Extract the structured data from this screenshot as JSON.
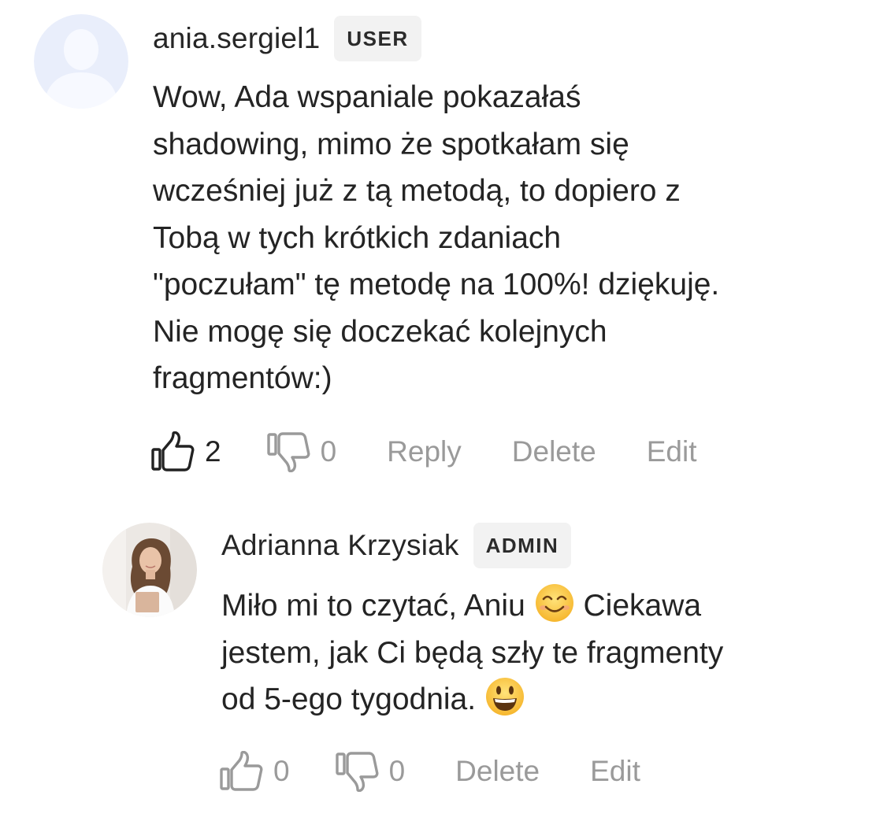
{
  "comments": [
    {
      "author": "ania.sergiel1",
      "badge": "USER",
      "avatar_icon": "default-user-icon",
      "lines": [
        "Wow, Ada wspaniale pokazałaś",
        "shadowing, mimo że spotkałam się",
        "wcześniej już z tą metodą, to dopiero z",
        "Tobą w tych krótkich zdaniach",
        "\"poczułam\" tę metodę na 100%! dziękuję.",
        "Nie mogę się doczekać kolejnych",
        "fragmentów:)"
      ],
      "likes": "2",
      "dislikes": "0",
      "actions": [
        "Reply",
        "Delete",
        "Edit"
      ]
    },
    {
      "author": "Adrianna Krzysiak",
      "badge": "ADMIN",
      "avatar_icon": "profile-photo",
      "line1_a": "Miło mi to czytać, Aniu",
      "line1_b": "Ciekawa",
      "line2": "jestem, jak Ci będą szły te fragmenty",
      "line3": "od 5-ego tygodnia.",
      "emoji_1": "smiling-face-icon",
      "emoji_2": "grinning-face-icon",
      "likes": "0",
      "dislikes": "0",
      "actions": [
        "Delete",
        "Edit"
      ]
    }
  ],
  "colors": {
    "text": "#242424",
    "muted": "#9a9a9a",
    "badge_bg": "#f2f2f2",
    "avatar_default_bg": "#e9eefb",
    "avatar_default_fg": "#f7f9ff"
  }
}
